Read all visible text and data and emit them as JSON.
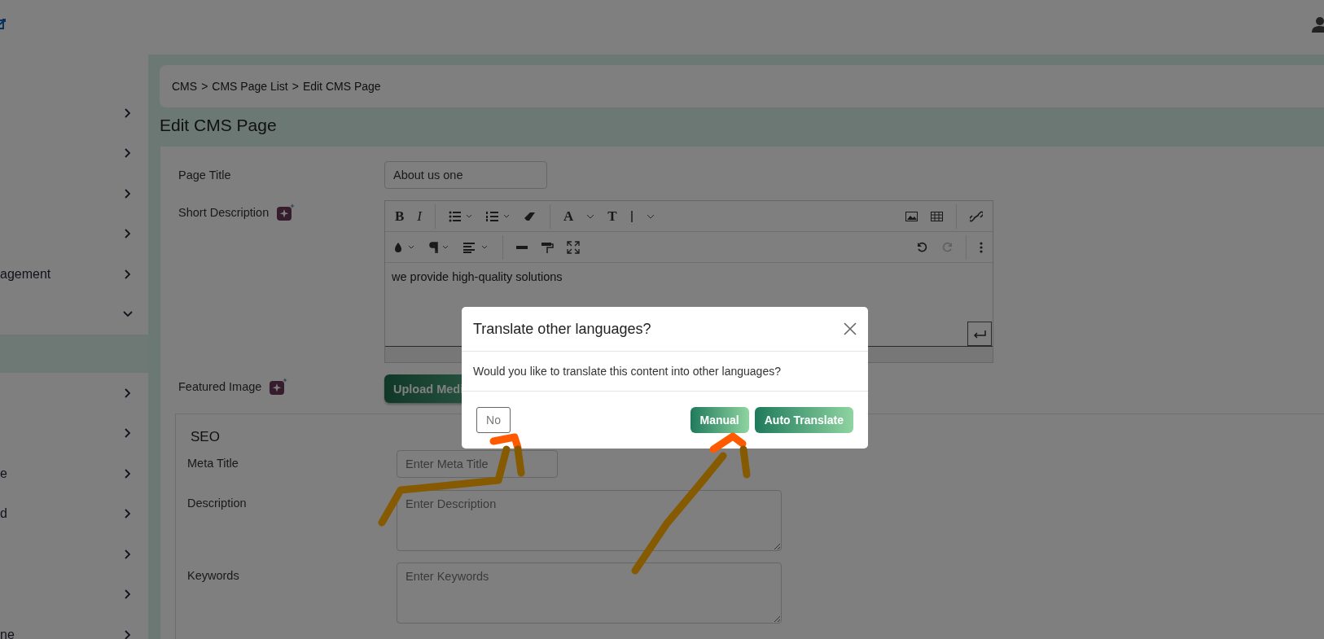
{
  "sidebar": {
    "items": [
      {
        "expanded": false
      },
      {
        "expanded": false
      },
      {
        "expanded": false
      },
      {
        "expanded": false
      },
      {
        "label": "agement",
        "expanded": false
      },
      {
        "expanded": true,
        "children": [
          {
            "selected": true
          }
        ]
      },
      {
        "expanded": false
      },
      {
        "expanded": false
      },
      {
        "label": "e",
        "expanded": false
      },
      {
        "label": "d",
        "expanded": false
      },
      {
        "expanded": false
      },
      {
        "expanded": false
      },
      {
        "label": "ne",
        "expanded": false
      }
    ]
  },
  "breadcrumb": [
    "CMS",
    ">",
    "CMS Page List",
    ">",
    "Edit CMS Page"
  ],
  "page_title": "Edit CMS Page",
  "form": {
    "page_title": {
      "label": "Page Title",
      "value": "About us one"
    },
    "short_description": {
      "label": "Short Description",
      "toolbar_glyphs": [
        "B",
        "I",
        "A",
        "T"
      ],
      "redo_disabled": true,
      "content": "we provide high-quality solutions"
    },
    "featured_image": {
      "label": "Featured Image",
      "button": "Upload Medi"
    },
    "seo": {
      "title": "SEO",
      "fields": [
        {
          "kind": "input",
          "label": "Meta Title",
          "placeholder": "Enter Meta Title"
        },
        {
          "kind": "textarea",
          "label": "Description",
          "placeholder": "Enter Description"
        },
        {
          "kind": "textarea",
          "label": "Keywords",
          "placeholder": "Enter Keywords"
        }
      ]
    }
  },
  "dialog": {
    "title": "Translate other languages?",
    "message": "Would you like to translate this content into other languages?",
    "buttons": [
      {
        "kind": "outline",
        "label": "No"
      },
      {
        "kind": "primary",
        "label": "Manual"
      },
      {
        "kind": "primary",
        "label": "Auto Translate"
      }
    ]
  }
}
